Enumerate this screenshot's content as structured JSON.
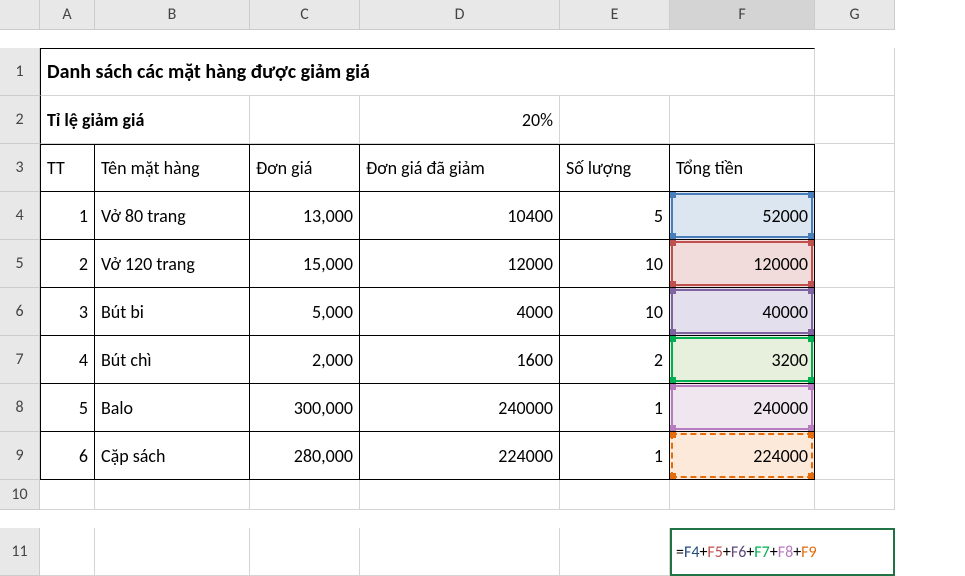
{
  "columns": {
    "corner": "",
    "A": "A",
    "B": "B",
    "C": "C",
    "D": "D",
    "E": "E",
    "F": "F",
    "G": "G"
  },
  "row_nums": {
    "r1": "1",
    "r2": "2",
    "r3": "3",
    "r4": "4",
    "r5": "5",
    "r6": "6",
    "r7": "7",
    "r8": "8",
    "r9": "9",
    "r10": "10",
    "r11": "11"
  },
  "title": "Danh sách các mặt hàng được giảm giá",
  "discount_label": "Tỉ lệ giảm giá",
  "discount_value": "20%",
  "headers": {
    "tt": "TT",
    "ten": "Tên mặt hàng",
    "dongia": "Đơn giá",
    "giagiam": "Đơn giá đã giảm",
    "soluong": "Số lượng",
    "tongtien": "Tổng tiền"
  },
  "rows": [
    {
      "tt": "1",
      "ten": "Vở 80 trang",
      "dongia": "13,000",
      "giagiam": "10400",
      "soluong": "5",
      "tongtien": "52000"
    },
    {
      "tt": "2",
      "ten": "Vở 120 trang",
      "dongia": "15,000",
      "giagiam": "12000",
      "soluong": "10",
      "tongtien": "120000"
    },
    {
      "tt": "3",
      "ten": "Bút bi",
      "dongia": "5,000",
      "giagiam": "4000",
      "soluong": "10",
      "tongtien": "40000"
    },
    {
      "tt": "4",
      "ten": "Bút chì",
      "dongia": "2,000",
      "giagiam": "1600",
      "soluong": "2",
      "tongtien": "3200"
    },
    {
      "tt": "5",
      "ten": "Balo",
      "dongia": "300,000",
      "giagiam": "240000",
      "soluong": "1",
      "tongtien": "240000"
    },
    {
      "tt": "6",
      "ten": "Cặp sách",
      "dongia": "280,000",
      "giagiam": "224000",
      "soluong": "1",
      "tongtien": "224000"
    }
  ],
  "formula": {
    "eq": "=",
    "parts": [
      "F4",
      "F5",
      "F6",
      "F7",
      "F8",
      "F9"
    ],
    "plus": "+"
  },
  "chart_data": {
    "type": "table",
    "title": "Danh sách các mặt hàng được giảm giá",
    "discount_rate_percent": 20,
    "columns": [
      "TT",
      "Tên mặt hàng",
      "Đơn giá",
      "Đơn giá đã giảm",
      "Số lượng",
      "Tổng tiền"
    ],
    "rows": [
      [
        1,
        "Vở 80 trang",
        13000,
        10400,
        5,
        52000
      ],
      [
        2,
        "Vở 120 trang",
        15000,
        12000,
        10,
        120000
      ],
      [
        3,
        "Bút bi",
        5000,
        4000,
        10,
        40000
      ],
      [
        4,
        "Bút chì",
        2000,
        1600,
        2,
        3200
      ],
      [
        5,
        "Balo",
        300000,
        240000,
        1,
        240000
      ],
      [
        6,
        "Cặp sách",
        280000,
        224000,
        1,
        224000
      ]
    ],
    "formula_cell": "F11",
    "formula": "=F4+F5+F6+F7+F8+F9"
  }
}
